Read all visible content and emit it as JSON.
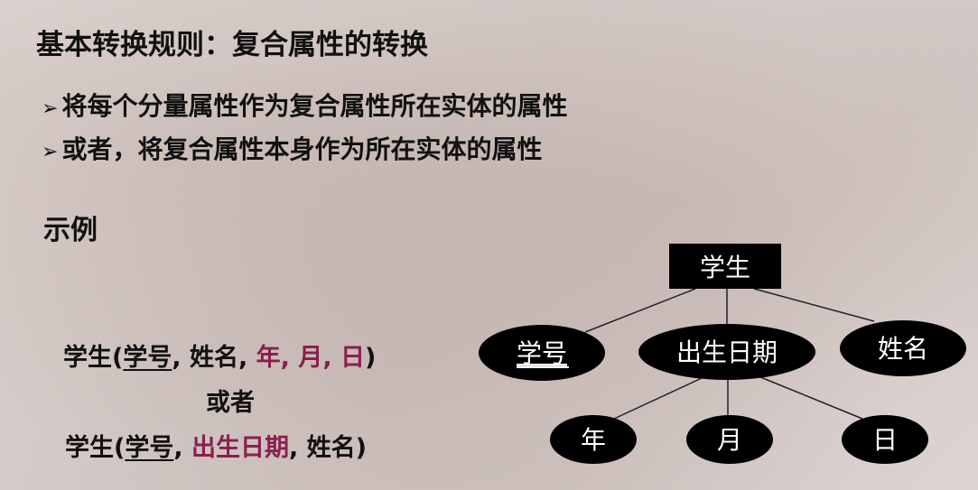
{
  "slide": {
    "title": "基本转换规则：复合属性的转换",
    "bullets": [
      "将每个分量属性作为复合属性所在实体的属性",
      "或者，将复合属性本身作为所在实体的属性"
    ],
    "example_heading": "示例"
  },
  "relations": {
    "rel1": {
      "prefix": "学生(",
      "key": "学号",
      "sep1": ", 姓名, ",
      "highlight": "年, 月, 日",
      "suffix": ")"
    },
    "or_text": "或者",
    "rel2": {
      "prefix": "学生(",
      "key": "学号",
      "sep1": ", ",
      "highlight": "出生日期",
      "sep2": ", 姓名)"
    }
  },
  "diagram": {
    "entity": "学生",
    "attributes": [
      "学号",
      "出生日期",
      "姓名"
    ],
    "key_attribute": "学号",
    "sub_attributes": [
      "年",
      "月",
      "日"
    ]
  },
  "colors": {
    "highlight": "#8a1f4f",
    "node_fill": "#000000",
    "node_text": "#ffffff"
  }
}
